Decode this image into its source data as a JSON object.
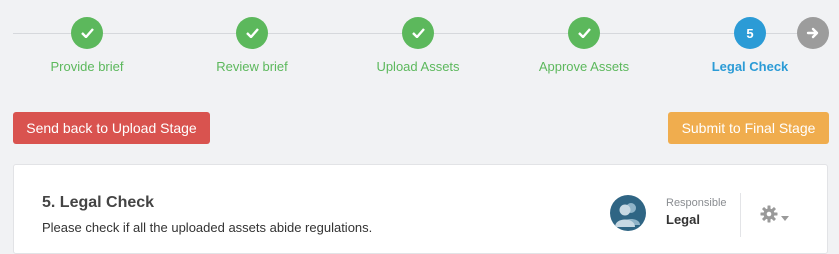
{
  "stepper": {
    "steps": [
      {
        "label": "Provide brief",
        "status": "done"
      },
      {
        "label": "Review brief",
        "status": "done"
      },
      {
        "label": "Upload Assets",
        "status": "done"
      },
      {
        "label": "Approve Assets",
        "status": "done"
      },
      {
        "label": "Legal Check",
        "status": "active",
        "number": "5"
      }
    ],
    "next_icon": "arrow-right-icon"
  },
  "actions": {
    "back_label": "Send back to Upload Stage",
    "submit_label": "Submit to Final Stage"
  },
  "stage": {
    "title": "5. Legal Check",
    "description": "Please check if all the uploaded assets abide regulations.",
    "responsible_caption": "Responsible",
    "responsible_name": "Legal",
    "avatar_icon": "users-icon",
    "settings_icon": "gear-icon"
  },
  "colors": {
    "done": "#5cb85c",
    "active": "#2b9bd6",
    "danger": "#d9534f",
    "warning": "#f0ad4e"
  }
}
